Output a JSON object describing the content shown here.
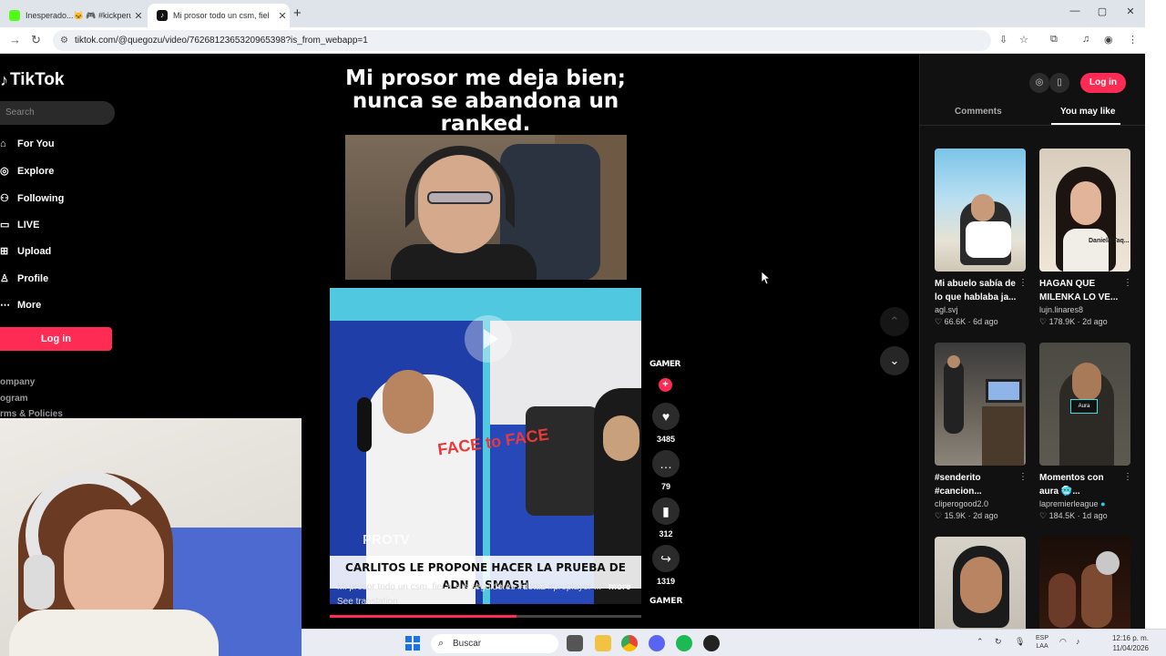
{
  "browser": {
    "tabs": [
      {
        "title": "Inesperado...🐱 🎮 #kickperu"
      },
      {
        "title": "Mi prosor todo un csm, fiel"
      }
    ],
    "url": "tiktok.com/@quegozu/video/7626812365320965398?is_from_webapp=1"
  },
  "sidebar": {
    "logo": "TikTok",
    "search_placeholder": "Search",
    "items": [
      {
        "label": "For You",
        "icon": "home-icon"
      },
      {
        "label": "Explore",
        "icon": "compass-icon"
      },
      {
        "label": "Following",
        "icon": "people-icon"
      },
      {
        "label": "LIVE",
        "icon": "live-icon"
      },
      {
        "label": "Upload",
        "icon": "upload-icon"
      },
      {
        "label": "Profile",
        "icon": "profile-icon"
      },
      {
        "label": "More",
        "icon": "more-icon"
      }
    ],
    "login": "Log in",
    "footer": [
      "ompany",
      "ogram",
      "rms & Policies"
    ]
  },
  "video": {
    "overlay_title": "Mi prosor me deja bien; nunca se abandona un ranked.",
    "caption_banner": "CARLITOS LE PROPONE HACER LA PRUEBA DE ADN A SMASH",
    "description": "Mi prosor todo un csm, fiel a sus seguidores #dota2 #proplayer ...",
    "more": "more",
    "see_translation": "See translation",
    "clip_logo": "PROTV",
    "face_tag": "FACE to FACE",
    "progress": 0.6
  },
  "actions": {
    "avatar_text": "GAMER",
    "likes": "3485",
    "comments": "79",
    "saves": "312",
    "shares": "1319"
  },
  "right_panel": {
    "login": "Log in",
    "tabs": [
      "Comments",
      "You may like"
    ],
    "active_tab": "You may like",
    "cards": [
      {
        "title": "Mi abuelo sabía de lo que hablaba ja...",
        "author": "agl.svj",
        "likes": "66.6K",
        "age": "6d ago"
      },
      {
        "title": "HAGAN QUE MILENKA LO VE...",
        "author": "lujn.linares8",
        "likes": "178.9K",
        "age": "2d ago"
      },
      {
        "title": "#senderito #cancion...",
        "author": "cliperogood2.0",
        "likes": "15.9K",
        "age": "2d ago"
      },
      {
        "title": "Momentos con aura 🥶...",
        "author": "lapremierleague",
        "likes": "184.5K",
        "age": "1d ago"
      }
    ],
    "card2_thumb_name": "Daniela Taq..."
  },
  "taskbar": {
    "search": "Buscar",
    "lang": [
      "ESP",
      "LAA"
    ],
    "time": "12:16 p. m.",
    "date": "11/04/2026"
  },
  "colors": {
    "accent": "#fe2c55",
    "page_bg": "#000000",
    "panel_bg": "#111111"
  }
}
